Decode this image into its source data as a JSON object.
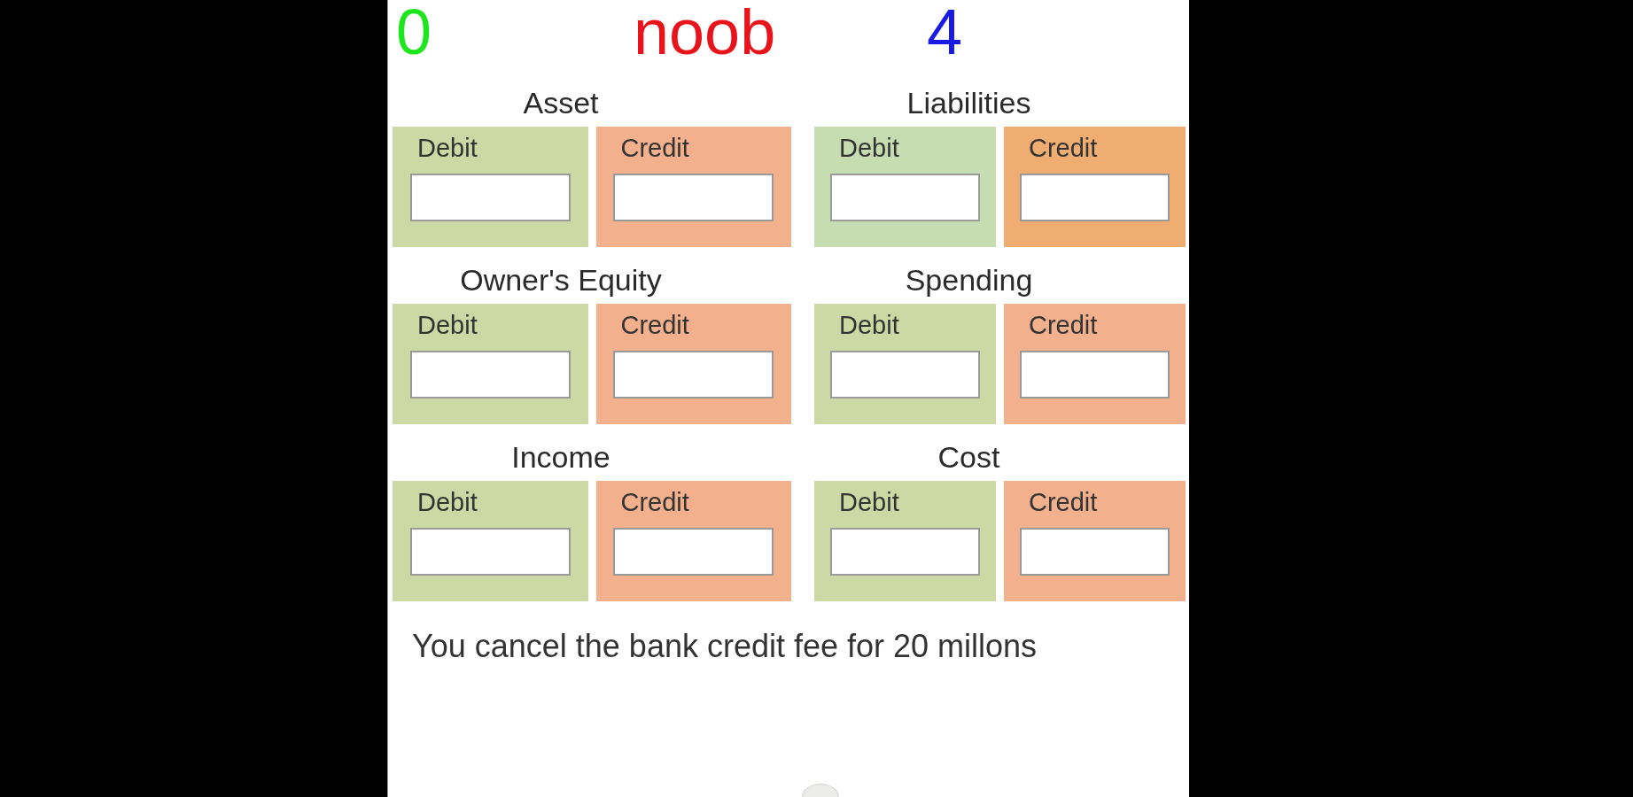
{
  "stats": [
    {
      "text": "0",
      "color": "#1ee61e"
    },
    {
      "text": "noob",
      "color": "#e8141b"
    },
    {
      "text": "4",
      "color": "#1a1ae6"
    }
  ],
  "accounts": [
    {
      "title": "Asset",
      "columns": [
        {
          "label": "Debit",
          "color": "#cdd9a4"
        },
        {
          "label": "Credit",
          "color": "#f2b08c"
        }
      ]
    },
    {
      "title": "Liabilities",
      "columns": [
        {
          "label": "Debit",
          "color": "#c5ddb0"
        },
        {
          "label": "Credit",
          "color": "#efad72"
        }
      ]
    },
    {
      "title": "Owner's Equity",
      "columns": [
        {
          "label": "Debit",
          "color": "#cdd9a4"
        },
        {
          "label": "Credit",
          "color": "#f2b08c"
        }
      ]
    },
    {
      "title": "Spending",
      "columns": [
        {
          "label": "Debit",
          "color": "#cdd9a4"
        },
        {
          "label": "Credit",
          "color": "#f2b08c"
        }
      ]
    },
    {
      "title": "Income",
      "columns": [
        {
          "label": "Debit",
          "color": "#cdd9a4"
        },
        {
          "label": "Credit",
          "color": "#f2b08c"
        }
      ]
    },
    {
      "title": "Cost",
      "columns": [
        {
          "label": "Debit",
          "color": "#cdd9a4"
        },
        {
          "label": "Credit",
          "color": "#f2b08c"
        }
      ]
    }
  ],
  "question": "You cancel the bank credit fee for 20 millons"
}
